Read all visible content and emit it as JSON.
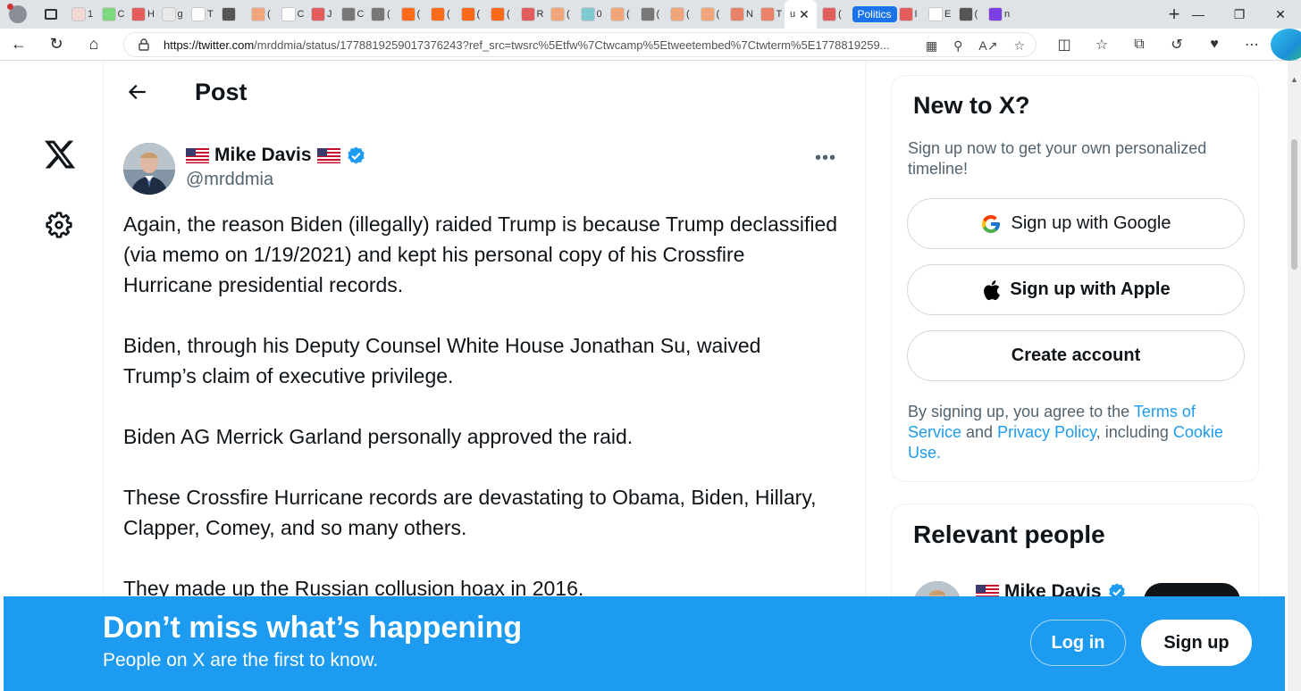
{
  "browser": {
    "url_host": "https://twitter.com",
    "url_rest": "/mrddmia/status/1778819259017376243?ref_src=twsrc%5Etfw%7Ctwcamp%5Etweetembed%7Ctwterm%5E1778819259...",
    "tab_group_label": "Politics",
    "tabs": [
      {
        "icon": "bi-icon",
        "color": "#f2d7d3",
        "text": "1"
      },
      {
        "icon": "g-icon",
        "color": "#7ed67e",
        "text": "C"
      },
      {
        "icon": "red-square-icon",
        "color": "#e35d5d",
        "text": "H"
      },
      {
        "icon": "search-icon",
        "color": "#e8e8e8",
        "text": "g"
      },
      {
        "icon": "document-icon",
        "color": "#ffffff",
        "text": "T"
      },
      {
        "icon": "image-icon",
        "color": "#555555",
        "text": ""
      },
      {
        "icon": "bookmark-icon",
        "color": "#f0a57a",
        "text": "("
      },
      {
        "icon": "document-icon",
        "color": "#ffffff",
        "text": "C"
      },
      {
        "icon": "video-icon",
        "color": "#e35d5d",
        "text": "J"
      },
      {
        "icon": "image-icon",
        "color": "#777777",
        "text": "C"
      },
      {
        "icon": "image-icon",
        "color": "#777777",
        "text": "("
      },
      {
        "icon": "bookmark-icon",
        "color": "#ff6b1a",
        "text": "("
      },
      {
        "icon": "bookmark-icon",
        "color": "#ff6b1a",
        "text": "("
      },
      {
        "icon": "bookmark-icon",
        "color": "#ff6b1a",
        "text": "("
      },
      {
        "icon": "bookmark-icon",
        "color": "#ff6b1a",
        "text": "("
      },
      {
        "icon": "video-icon",
        "color": "#e35d5d",
        "text": "R"
      },
      {
        "icon": "bookmark-icon",
        "color": "#f0a57a",
        "text": "("
      },
      {
        "icon": "p-icon",
        "color": "#7ecbcf",
        "text": "0"
      },
      {
        "icon": "bookmark-icon",
        "color": "#f0a57a",
        "text": "("
      },
      {
        "icon": "image-icon",
        "color": "#777777",
        "text": "("
      },
      {
        "icon": "bookmark-icon",
        "color": "#f0a57a",
        "text": "("
      },
      {
        "icon": "bookmark-icon",
        "color": "#f0a57a",
        "text": "("
      },
      {
        "icon": "r-icon",
        "color": "#e8836a",
        "text": "N"
      },
      {
        "icon": "r-icon",
        "color": "#e8836a",
        "text": "T"
      }
    ],
    "active_tab_text": "u",
    "tabs_after": [
      {
        "icon": "video-icon",
        "color": "#e35d5d",
        "text": "("
      },
      {
        "icon": "video-icon",
        "color": "#e35d5d",
        "text": "I"
      },
      {
        "icon": "document-icon",
        "color": "#ffffff",
        "text": "E"
      },
      {
        "icon": "image-icon",
        "color": "#555555",
        "text": "("
      },
      {
        "icon": "y-icon",
        "color": "#7b3fe4",
        "text": "n"
      }
    ]
  },
  "page": {
    "title": "Post",
    "author": {
      "display_name": "Mike Davis",
      "handle": "@mrddmia",
      "verified": true
    },
    "more_label": "•••",
    "paragraphs": [
      "Again, the reason Biden (illegally) raided Trump is because Trump declassified (via memo on 1/19/2021) and kept his personal copy of his Crossfire Hurricane presidential records.",
      "Biden, through his Deputy Counsel White House Jonathan Su, waived Trump’s claim of executive privilege.",
      "Biden AG Merrick Garland personally approved the raid.",
      "These Crossfire Hurricane records are devastating to Obama, Biden, Hillary, Clapper, Comey, and so many others.",
      "They made up the Russian collusion hoax in 2016."
    ]
  },
  "sidebar": {
    "new_to_x": {
      "title": "New to X?",
      "subtitle": "Sign up now to get your own personalized timeline!",
      "google_label": "Sign up with Google",
      "apple_label": "Sign up with Apple",
      "create_label": "Create account",
      "terms_prefix": "By signing up, you agree to the ",
      "terms_link": "Terms of Service",
      "terms_mid": " and ",
      "privacy_link": "Privacy Policy",
      "terms_mid2": ", including ",
      "cookie_link": "Cookie Use."
    },
    "relevant": {
      "title": "Relevant people",
      "person_name": "Mike Davis"
    }
  },
  "banner": {
    "title": "Don’t miss what’s happening",
    "subtitle": "People on X are the first to know.",
    "login_label": "Log in",
    "signup_label": "Sign up"
  },
  "colors": {
    "brand_blue": "#1d9bf0",
    "text_primary": "#0f1419",
    "text_secondary": "#536471"
  }
}
